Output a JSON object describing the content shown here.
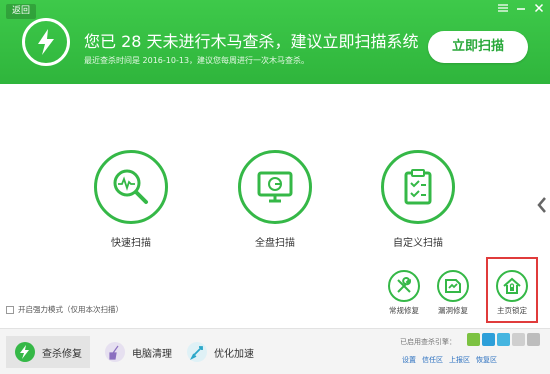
{
  "colors": {
    "brand_green": "#35b847",
    "highlight_red": "#e03b3b"
  },
  "header": {
    "back_label": "返回",
    "headline": "您已 28 天未进行木马查杀，建议立即扫描系统",
    "subline": "最近查杀时间是 2016-10-13，建议您每周进行一次木马查杀。",
    "scan_now_label": "立即扫描",
    "window_buttons": [
      "menu-icon",
      "minimize-icon",
      "close-icon"
    ]
  },
  "scan_options": [
    {
      "label": "快速扫描",
      "icon": "quick-scan-magnifier-icon"
    },
    {
      "label": "全盘扫描",
      "icon": "full-disk-monitor-icon"
    },
    {
      "label": "自定义扫描",
      "icon": "custom-scan-clipboard-icon"
    }
  ],
  "tools": [
    {
      "label": "常规修复",
      "icon": "wrench-screwdriver-icon"
    },
    {
      "label": "漏洞修复",
      "icon": "vulnerability-repair-icon"
    },
    {
      "label": "主页锁定",
      "icon": "homepage-lock-icon",
      "highlighted": true
    }
  ],
  "strong_mode_label": "开启强力模式（仅用本次扫描）",
  "bottom_tabs": [
    {
      "label": "查杀修复",
      "icon": "lightning-icon",
      "active": true
    },
    {
      "label": "电脑清理",
      "icon": "broom-icon",
      "active": false
    },
    {
      "label": "优化加速",
      "icon": "rocket-icon",
      "active": false
    }
  ],
  "engine_label": "已启用查杀引擎：",
  "bottom_links": [
    "设置",
    "信任区",
    "上报区",
    "恢复区"
  ]
}
